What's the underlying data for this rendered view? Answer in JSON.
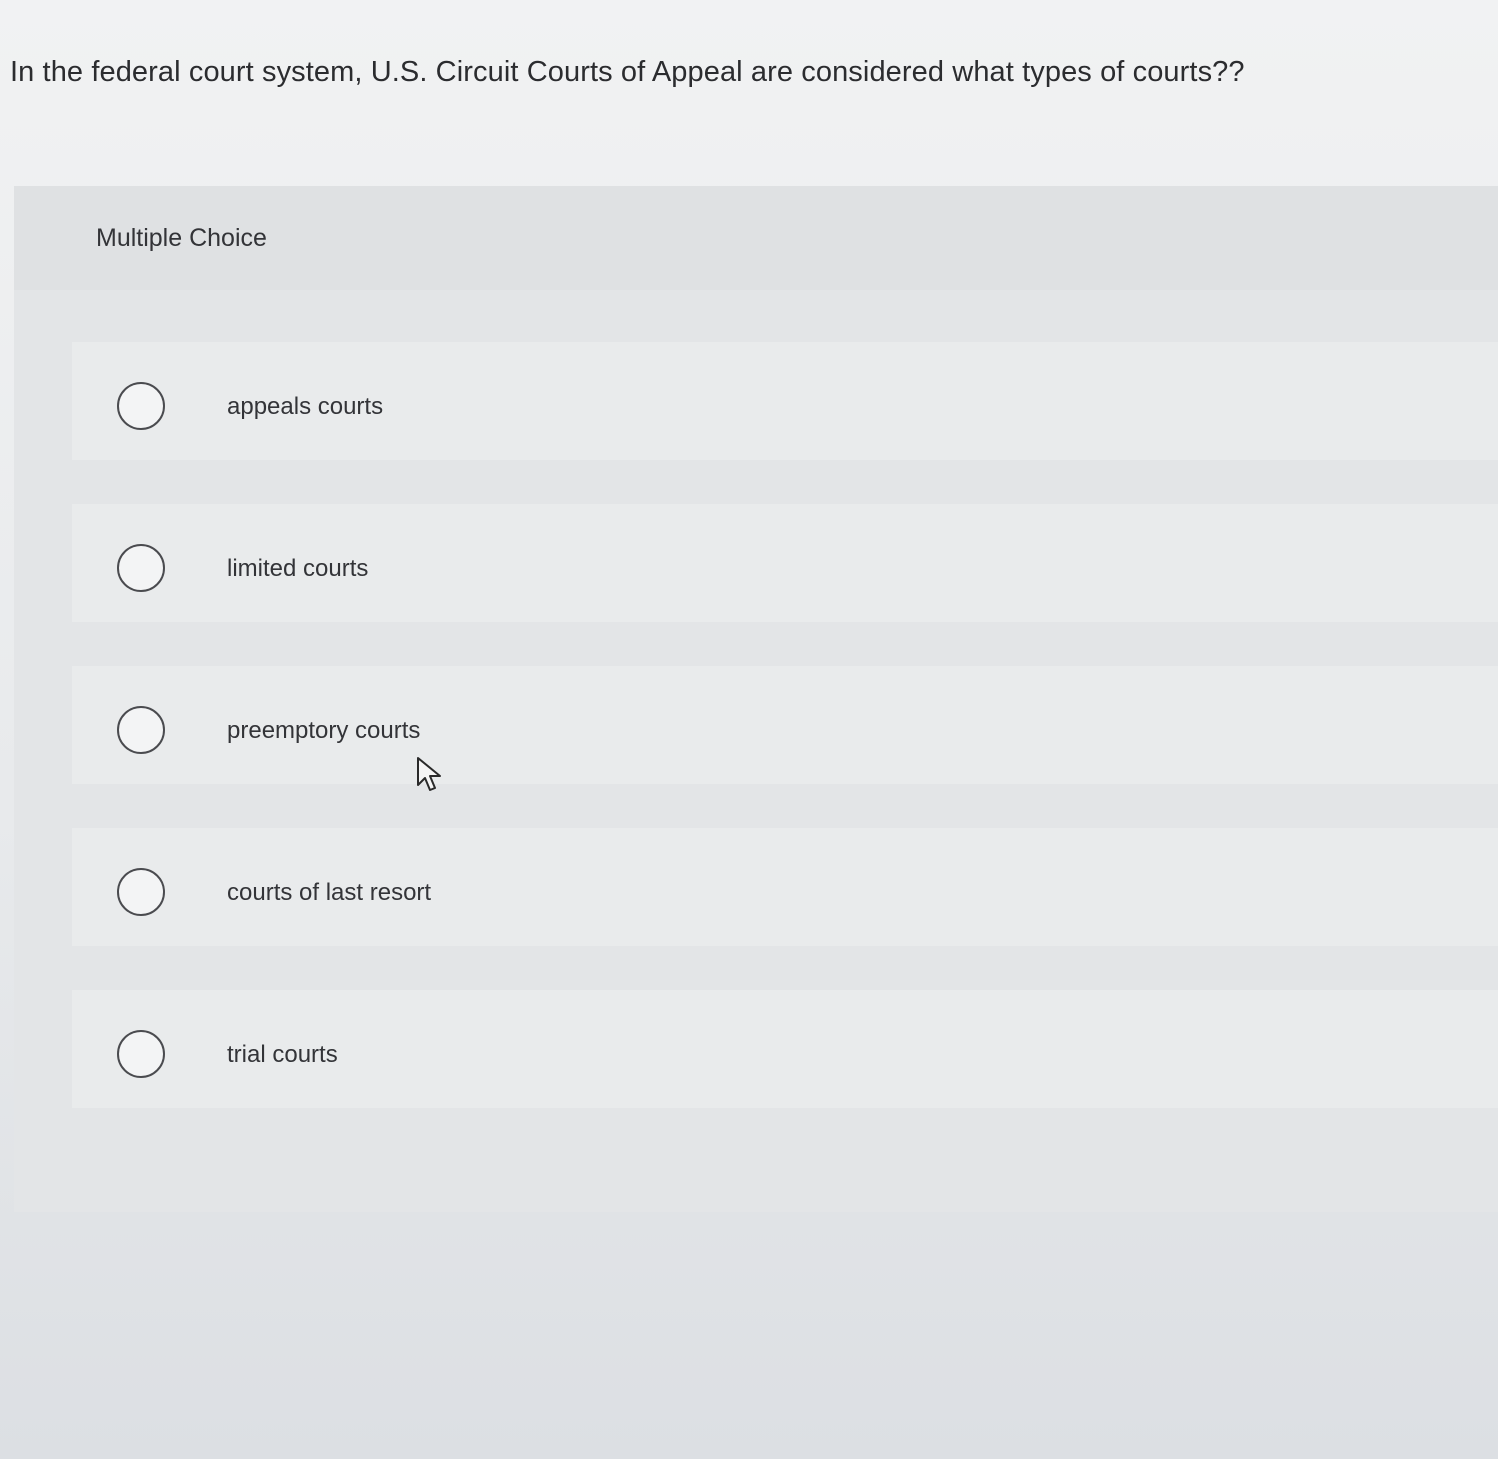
{
  "question": {
    "text": "In the federal court system, U.S. Circuit Courts of Appeal are considered what types of courts??"
  },
  "panel": {
    "title": "Multiple Choice"
  },
  "options": [
    {
      "label": "appeals courts",
      "selected": false
    },
    {
      "label": "limited courts",
      "selected": false
    },
    {
      "label": "preemptory courts",
      "selected": false
    },
    {
      "label": "courts of last resort",
      "selected": false
    },
    {
      "label": "trial courts",
      "selected": false
    }
  ],
  "icons": {
    "radio": "radio-unchecked-icon",
    "cursor": "mouse-pointer-icon"
  }
}
